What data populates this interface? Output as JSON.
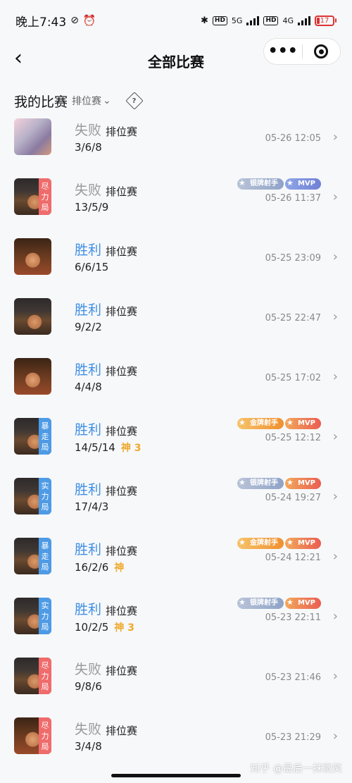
{
  "status": {
    "time": "晚上7:43",
    "net1": "5G",
    "net2": "4G",
    "battery": "17"
  },
  "nav": {
    "title": "全部比赛",
    "back_icon": "chevron-left-icon",
    "more_icon": "more-dots-icon",
    "close_icon": "target-icon"
  },
  "section": {
    "title": "我的比赛",
    "filter": "排位赛",
    "help_icon": "question-diamond-icon"
  },
  "matches": [
    {
      "result": "失败",
      "mode": "排位赛",
      "kda": "3/6/8",
      "time": "05-26 12:05",
      "badge": "",
      "honors": []
    },
    {
      "result": "失败",
      "mode": "排位赛",
      "kda": "13/5/9",
      "time": "05-26 11:37",
      "badge": "尽力局",
      "honors": [
        "银牌射手",
        "MVP"
      ]
    },
    {
      "result": "胜利",
      "mode": "排位赛",
      "kda": "6/6/15",
      "time": "05-25 23:09",
      "badge": "",
      "honors": []
    },
    {
      "result": "胜利",
      "mode": "排位赛",
      "kda": "9/2/2",
      "time": "05-25 22:47",
      "badge": "",
      "honors": []
    },
    {
      "result": "胜利",
      "mode": "排位赛",
      "kda": "4/4/8",
      "time": "05-25 17:02",
      "badge": "",
      "honors": []
    },
    {
      "result": "胜利",
      "mode": "排位赛",
      "kda": "14/5/14",
      "time": "05-25 12:12",
      "badge": "暴走局",
      "honors": [
        "金牌射手",
        "MVP"
      ],
      "extra": "神 3"
    },
    {
      "result": "胜利",
      "mode": "排位赛",
      "kda": "17/4/3",
      "time": "05-24 19:27",
      "badge": "实力局",
      "honors": [
        "银牌射手",
        "MVP"
      ]
    },
    {
      "result": "胜利",
      "mode": "排位赛",
      "kda": "16/2/6",
      "time": "05-24 12:21",
      "badge": "暴走局",
      "honors": [
        "金牌射手",
        "MVP"
      ],
      "extra": "神"
    },
    {
      "result": "胜利",
      "mode": "排位赛",
      "kda": "10/2/5",
      "time": "05-23 22:11",
      "badge": "实力局",
      "honors": [
        "银牌射手",
        "MVP"
      ],
      "extra": "神 3"
    },
    {
      "result": "失败",
      "mode": "排位赛",
      "kda": "9/8/6",
      "time": "05-23 21:46",
      "badge": "尽力局",
      "honors": []
    },
    {
      "result": "失败",
      "mode": "排位赛",
      "kda": "3/4/8",
      "time": "05-23 21:29",
      "badge": "尽力局",
      "honors": []
    }
  ],
  "watermark": "知乎 @最后一抹微笑"
}
